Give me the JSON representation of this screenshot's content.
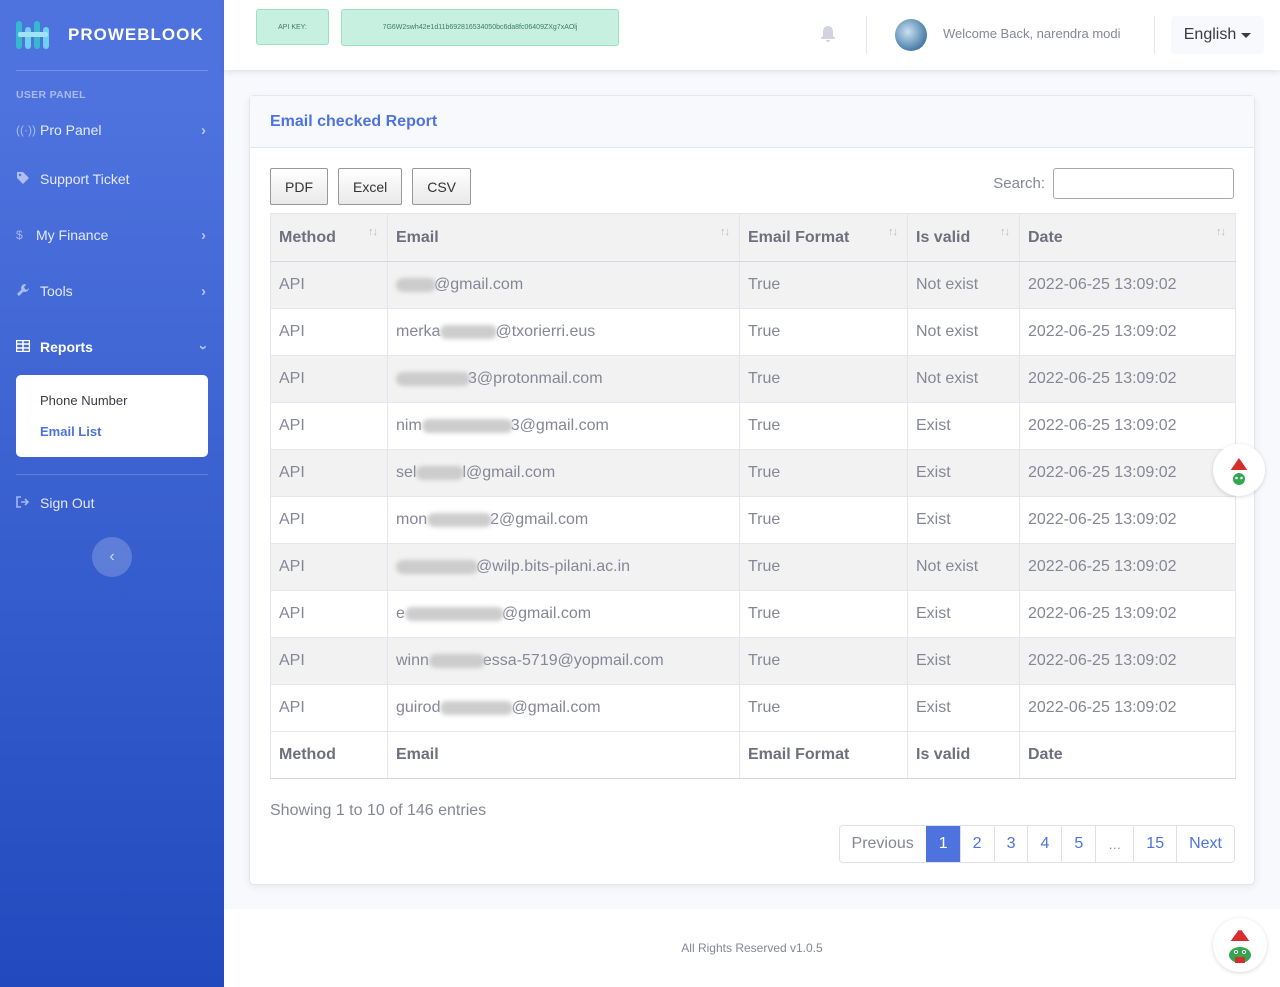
{
  "brand": {
    "name": "PROWEBLOOK"
  },
  "sidebar": {
    "heading": "USER PANEL",
    "items": [
      {
        "label": "Pro Panel",
        "icon": "broadcast-icon"
      },
      {
        "label": "Support Ticket",
        "icon": "tag-icon"
      },
      {
        "label": "My Finance",
        "icon": "dollar-icon"
      },
      {
        "label": "Tools",
        "icon": "wrench-icon"
      },
      {
        "label": "Reports",
        "icon": "table-icon"
      }
    ],
    "submenu": [
      {
        "label": "Phone Number"
      },
      {
        "label": "Email List"
      }
    ],
    "signout": "Sign Out"
  },
  "topbar": {
    "api_label": "API KEY:",
    "api_key": "7G6W2swh42e1d11b692816534050bc6da8fc06409ZXg7xAOlj",
    "welcome": "Welcome Back, narendra modi",
    "language": "English"
  },
  "card": {
    "title": "Email checked Report",
    "export": [
      "PDF",
      "Excel",
      "CSV"
    ],
    "search_label": "Search:",
    "columns": [
      "Method",
      "Email",
      "Email Format",
      "Is valid",
      "Date"
    ],
    "rows": [
      {
        "method": "API",
        "email_prefix": "",
        "email_suffix": "@gmail.com",
        "format": "True",
        "valid": "Not exist",
        "date": "2022-06-25 13:09:02"
      },
      {
        "method": "API",
        "email_prefix": "merka",
        "email_suffix": "@txorierri.eus",
        "format": "True",
        "valid": "Not exist",
        "date": "2022-06-25 13:09:02"
      },
      {
        "method": "API",
        "email_prefix": "",
        "email_suffix": "3@protonmail.com",
        "format": "True",
        "valid": "Not exist",
        "date": "2022-06-25 13:09:02"
      },
      {
        "method": "API",
        "email_prefix": "nim",
        "email_suffix": "3@gmail.com",
        "format": "True",
        "valid": "Exist",
        "date": "2022-06-25 13:09:02"
      },
      {
        "method": "API",
        "email_prefix": "sel",
        "email_suffix": "l@gmail.com",
        "format": "True",
        "valid": "Exist",
        "date": "2022-06-25 13:09:02"
      },
      {
        "method": "API",
        "email_prefix": "mon",
        "email_suffix": "2@gmail.com",
        "format": "True",
        "valid": "Exist",
        "date": "2022-06-25 13:09:02"
      },
      {
        "method": "API",
        "email_prefix": "",
        "email_suffix": "@wilp.bits-pilani.ac.in",
        "format": "True",
        "valid": "Not exist",
        "date": "2022-06-25 13:09:02"
      },
      {
        "method": "API",
        "email_prefix": "e",
        "email_suffix": "@gmail.com",
        "format": "True",
        "valid": "Exist",
        "date": "2022-06-25 13:09:02"
      },
      {
        "method": "API",
        "email_prefix": "winn",
        "email_suffix": "essa-5719@yopmail.com",
        "format": "True",
        "valid": "Exist",
        "date": "2022-06-25 13:09:02"
      },
      {
        "method": "API",
        "email_prefix": "guirod",
        "email_suffix": "@gmail.com",
        "format": "True",
        "valid": "Exist",
        "date": "2022-06-25 13:09:02"
      }
    ],
    "info": "Showing 1 to 10 of 146 entries",
    "pagination": [
      "Previous",
      "1",
      "2",
      "3",
      "4",
      "5",
      "…",
      "15",
      "Next"
    ]
  },
  "footer": {
    "text": "All Rights Reserved v1.0.5"
  },
  "colors": {
    "primary": "#4e73df",
    "sidebar_dark": "#224abe",
    "api_bg": "#c8f0e1"
  }
}
